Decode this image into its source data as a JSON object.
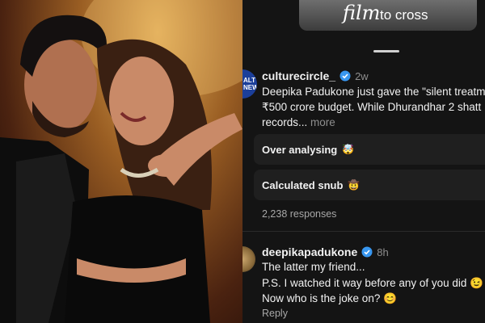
{
  "video": {
    "word_a": "film",
    "word_b": "to cross"
  },
  "post": {
    "avatar_text": "ALT\nNEW",
    "author": "culturecircle_",
    "time": "2w",
    "lines": [
      "Deepika Padukone just gave the \"silent treatm",
      "₹500 crore budget. While Dhurandhar 2 shatt",
      "records..."
    ],
    "more": "more"
  },
  "poll": {
    "options": [
      {
        "label": "Over analysing",
        "emoji": "🤯"
      },
      {
        "label": "Calculated snub",
        "emoji": "🤠"
      }
    ],
    "responses": "2,238 responses"
  },
  "reply": {
    "author": "deepikapadukone",
    "time": "8h",
    "lines": [
      "The latter my friend...",
      "P.S. I watched it way before any of you did 😉",
      "Now who is the joke on? 😊"
    ],
    "reply_label": "Reply"
  },
  "colors": {
    "verified": "#3897f0",
    "panel_bg": "#141414",
    "option_bg": "#1f1f1f"
  },
  "icons": {
    "verified": "verified-badge-icon"
  }
}
